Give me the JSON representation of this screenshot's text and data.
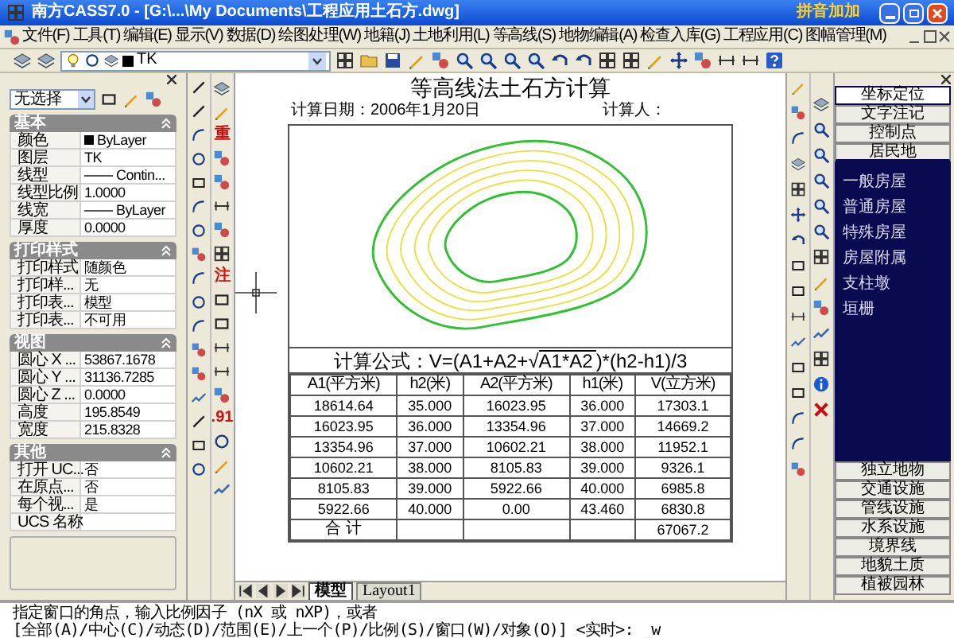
{
  "window": {
    "title": "南方CASS7.0 - [G:\\...\\My Documents\\工程应用土石方.dwg]",
    "ime_badge": "拼音加加"
  },
  "menu": [
    "文件(F)",
    "工具(T)",
    "编辑(E)",
    "显示(V)",
    "数据(D)",
    "绘图处理(W)",
    "地籍(J)",
    "土地利用(L)",
    "等高线(S)",
    "地物编辑(A)",
    "检查入库(G)",
    "工程应用(C)",
    "图幅管理(M)"
  ],
  "toolbar": {
    "layer": "TK"
  },
  "properties": {
    "selection": "无选择",
    "sections": [
      {
        "title": "基本",
        "expanded": true,
        "rows": [
          {
            "label": "颜色",
            "value": "ByLayer",
            "kind": "color"
          },
          {
            "label": "图层",
            "value": "TK",
            "kind": "text"
          },
          {
            "label": "线型",
            "value": "Contin...",
            "kind": "linetype"
          },
          {
            "label": "线型比例",
            "value": "1.0000",
            "kind": "text"
          },
          {
            "label": "线宽",
            "value": "ByLayer",
            "kind": "linetype"
          },
          {
            "label": "厚度",
            "value": "0.0000",
            "kind": "text"
          }
        ]
      },
      {
        "title": "打印样式",
        "expanded": true,
        "rows": [
          {
            "label": "打印样式",
            "value": "随颜色",
            "kind": "text"
          },
          {
            "label": "打印样...",
            "value": "无",
            "kind": "text"
          },
          {
            "label": "打印表...",
            "value": "模型",
            "kind": "text"
          },
          {
            "label": "打印表...",
            "value": "不可用",
            "kind": "text"
          }
        ]
      },
      {
        "title": "视图",
        "expanded": true,
        "rows": [
          {
            "label": "圆心 X ...",
            "value": "53867.1678",
            "kind": "text"
          },
          {
            "label": "圆心 Y ...",
            "value": "31136.7285",
            "kind": "text"
          },
          {
            "label": "圆心 Z ...",
            "value": "0.0000",
            "kind": "text"
          },
          {
            "label": "高度",
            "value": "195.8549",
            "kind": "text"
          },
          {
            "label": "宽度",
            "value": "215.8328",
            "kind": "text"
          }
        ]
      },
      {
        "title": "其他",
        "expanded": true,
        "rows": [
          {
            "label": "打开 UC...",
            "value": "否",
            "kind": "text"
          },
          {
            "label": "在原点...",
            "value": "否",
            "kind": "text"
          },
          {
            "label": "每个视...",
            "value": "是",
            "kind": "text"
          },
          {
            "label": "UCS 名称",
            "kind": "text"
          }
        ]
      }
    ]
  },
  "drawing": {
    "title": "等高线法土石方计算",
    "date": "计算日期：2006年1月20日",
    "person": "计算人：",
    "formula": {
      "prefix": "计算公式：V=(A1+A2+√",
      "radicand": "A1*A2",
      "suffix": ")*(h2-h1)/3"
    },
    "columns": [
      "A1(平方米)",
      "h2(米)",
      "A2(平方米)",
      "h1(米)",
      "V(立方米)"
    ],
    "rows": [
      [
        "18614.64",
        "35.000",
        "16023.95",
        "36.000",
        "17303.1"
      ],
      [
        "16023.95",
        "36.000",
        "13354.96",
        "37.000",
        "14669.2"
      ],
      [
        "13354.96",
        "37.000",
        "10602.21",
        "38.000",
        "11952.1"
      ],
      [
        "10602.21",
        "38.000",
        "8105.83",
        "39.000",
        "9326.1"
      ],
      [
        "8105.83",
        "39.000",
        "5922.66",
        "40.000",
        "6985.8"
      ],
      [
        "5922.66",
        "40.000",
        "0.00",
        "43.460",
        "6830.8"
      ]
    ],
    "total": {
      "label": "合 计",
      "value": "67067.2"
    }
  },
  "layout_tabs": [
    {
      "label": "模型",
      "selected": true
    },
    {
      "label": "Layout1",
      "selected": false
    }
  ],
  "drawing_toolbar_glyphs": [
    "重",
    "注",
    ".91"
  ],
  "categories": [
    {
      "label": "坐标定位",
      "selected": true,
      "expanded": false
    },
    {
      "label": "文字注记",
      "selected": false,
      "expanded": false
    },
    {
      "label": "控制点",
      "selected": false,
      "expanded": false
    },
    {
      "label": "居民地",
      "selected": false,
      "expanded": true,
      "children": [
        "一般房屋",
        "普通房屋",
        "特殊房屋",
        "房屋附属",
        "支柱墩",
        "垣栅"
      ]
    },
    {
      "label": "独立地物",
      "selected": false,
      "expanded": false
    },
    {
      "label": "交通设施",
      "selected": false,
      "expanded": false
    },
    {
      "label": "管线设施",
      "selected": false,
      "expanded": false
    },
    {
      "label": "水系设施",
      "selected": false,
      "expanded": false
    },
    {
      "label": "境界线",
      "selected": false,
      "expanded": false
    },
    {
      "label": "地貌土质",
      "selected": false,
      "expanded": false
    },
    {
      "label": "植被园林",
      "selected": false,
      "expanded": false
    }
  ],
  "command_lines": [
    "指定窗口的角点，输入比例因子 (nX 或 nXP)，或者",
    "[全部(A)/中心(C)/动态(D)/范围(E)/上一个(P)/比例(S)/窗口(W)/对象(O)] <实时>: _w"
  ]
}
